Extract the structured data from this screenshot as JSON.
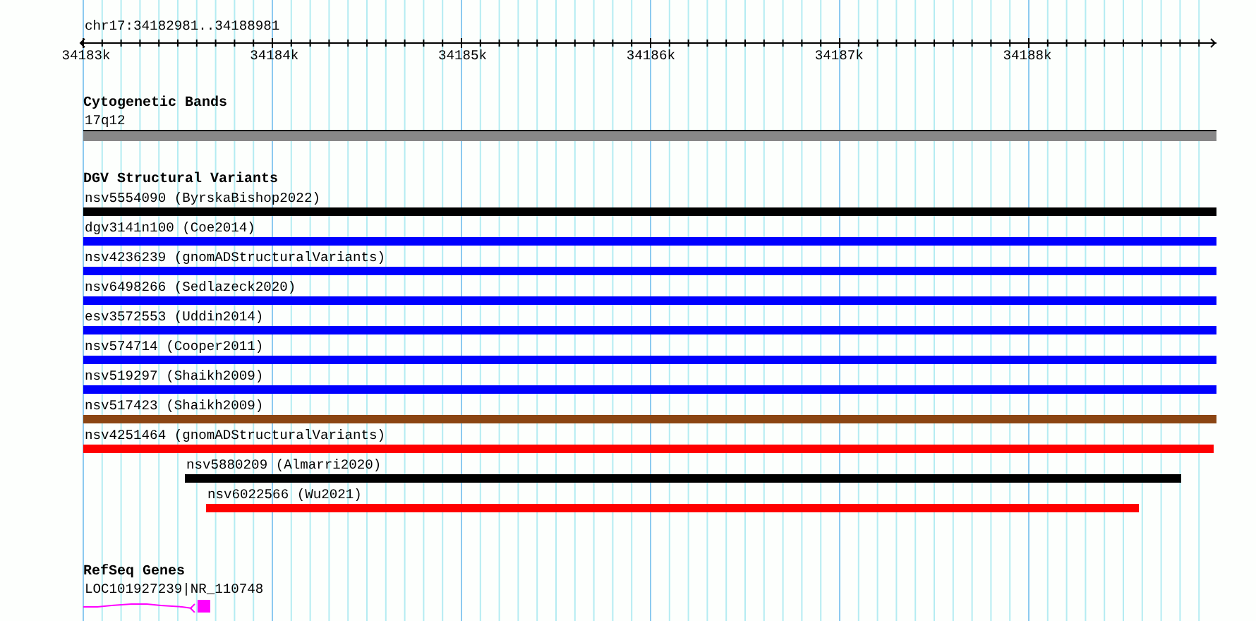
{
  "ruler": {
    "region": "chr17:34182981..34188981",
    "ticks": [
      "34183k",
      "34184k",
      "34185k",
      "34186k",
      "34187k",
      "34188k"
    ]
  },
  "tracks": [
    {
      "kind": "band",
      "title": "Cytogenetic Bands",
      "features": [
        {
          "label": "17q12",
          "color": "#888888"
        }
      ]
    },
    {
      "kind": "variants",
      "title": "DGV Structural Variants",
      "features": [
        {
          "label": "nsv5554090 (ByrskaBishop2022)",
          "color": "#000000"
        },
        {
          "label": "dgv3141n100 (Coe2014)",
          "color": "#0000ff"
        },
        {
          "label": "nsv4236239 (gnomADStructuralVariants)",
          "color": "#0000ff"
        },
        {
          "label": "nsv6498266 (Sedlazeck2020)",
          "color": "#0000ff"
        },
        {
          "label": "esv3572553 (Uddin2014)",
          "color": "#0000ff"
        },
        {
          "label": "nsv574714 (Cooper2011)",
          "color": "#0000ff"
        },
        {
          "label": "nsv519297 (Shaikh2009)",
          "color": "#0000ff"
        },
        {
          "label": "nsv517423 (Shaikh2009)",
          "color": "#8b4513"
        },
        {
          "label": "nsv4251464 (gnomADStructuralVariants)",
          "color": "#ff0000"
        },
        {
          "label": "nsv5880209 (Almarri2020)",
          "color": "#000000"
        },
        {
          "label": "nsv6022566 (Wu2021)",
          "color": "#ff0000"
        }
      ]
    },
    {
      "kind": "genes",
      "title": "RefSeq Genes",
      "features": [
        {
          "label": "LOC101927239|NR_110748",
          "color": "#ff00ff"
        }
      ]
    }
  ]
}
